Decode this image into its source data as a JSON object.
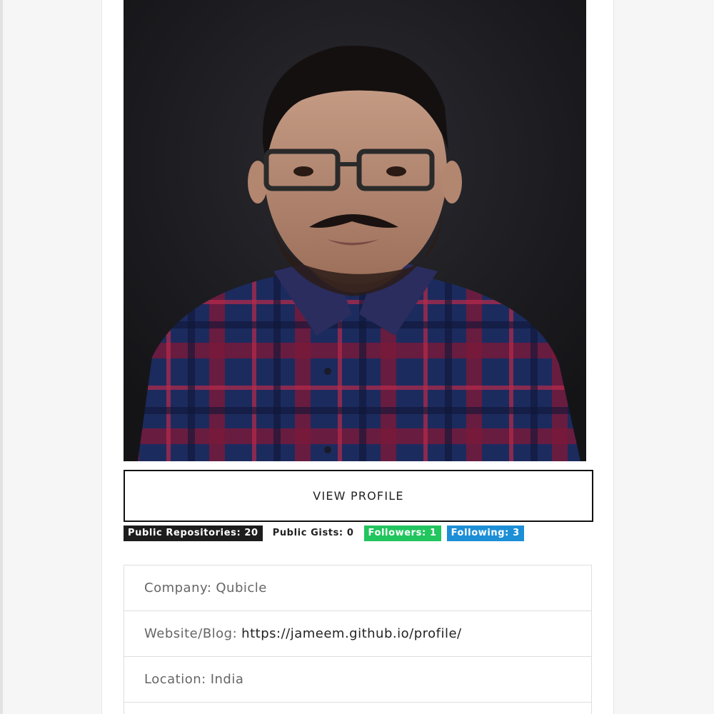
{
  "profile": {
    "photo_alt": "profile-photo",
    "view_button": "VIEW PROFILE"
  },
  "stats": {
    "repos": "Public Repositories: 20",
    "gists": "Public Gists: 0",
    "followers": "Followers: 1",
    "following": "Following: 3"
  },
  "details": {
    "company_label": "Company:",
    "company_value": "Qubicle",
    "website_label": "Website/Blog:",
    "website_value": "https://jameem.github.io/profile/",
    "location_label": "Location:",
    "location_value": "India"
  },
  "colors": {
    "repos_badge": "#1d1d1d",
    "followers_badge": "#22c55e",
    "following_badge": "#1d8fd6"
  }
}
